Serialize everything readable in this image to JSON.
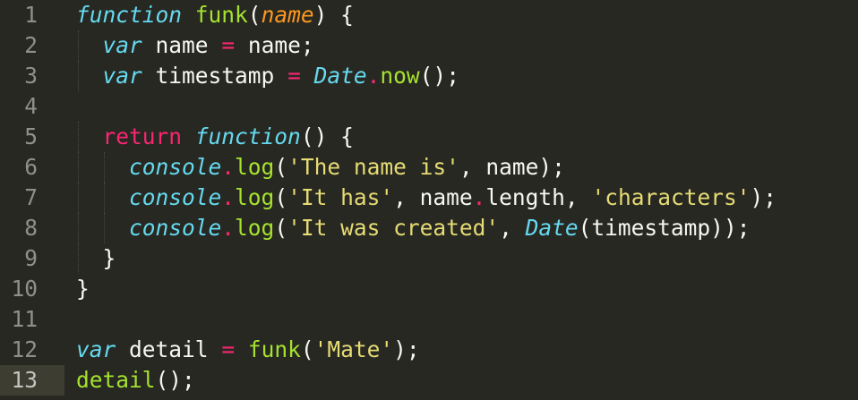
{
  "editor": {
    "language": "javascript",
    "theme": "Monokai",
    "active_line": 13,
    "lines": [
      {
        "number": "1",
        "text": "function funk(name) {"
      },
      {
        "number": "2",
        "text": "  var name = name;"
      },
      {
        "number": "3",
        "text": "  var timestamp = Date.now();"
      },
      {
        "number": "4",
        "text": ""
      },
      {
        "number": "5",
        "text": "  return function() {"
      },
      {
        "number": "6",
        "text": "    console.log('The name is', name);"
      },
      {
        "number": "7",
        "text": "    console.log('It has', name.length, 'characters');"
      },
      {
        "number": "8",
        "text": "    console.log('It was created', Date(timestamp));"
      },
      {
        "number": "9",
        "text": "  }"
      },
      {
        "number": "10",
        "text": "}"
      },
      {
        "number": "11",
        "text": ""
      },
      {
        "number": "12",
        "text": "var detail = funk('Mate');"
      },
      {
        "number": "13",
        "text": "detail();"
      }
    ]
  },
  "colors": {
    "background": "#272822",
    "foreground": "#f8f8f2",
    "keyword": "#f92672",
    "storage": "#66d9ef",
    "function_name": "#a6e22e",
    "parameter": "#fd971f",
    "string": "#e6db74",
    "gutter_text": "#8f908a",
    "active_line_bg": "#3e3d32"
  }
}
